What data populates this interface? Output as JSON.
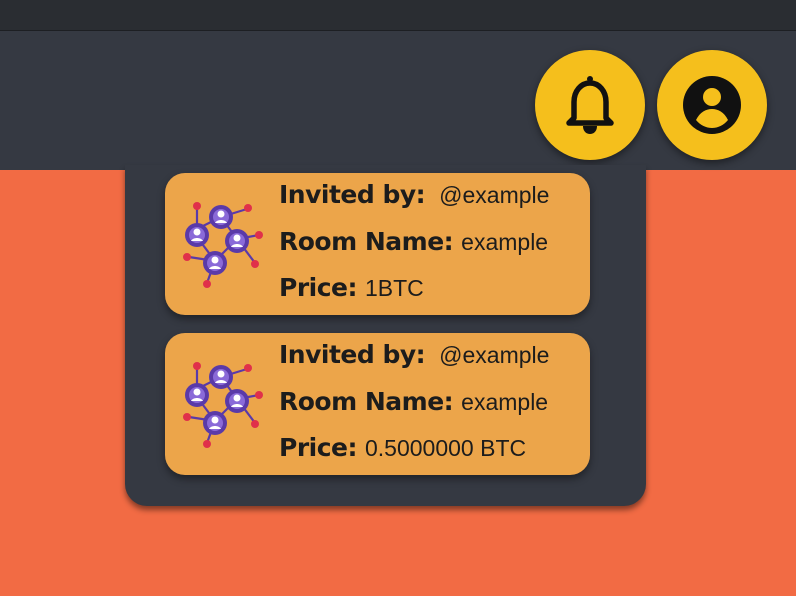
{
  "header": {
    "notification_icon": "bell-icon",
    "account_icon": "user-circle-icon"
  },
  "invites": [
    {
      "icon": "network-people-icon",
      "invited_by_label": "Invited by:",
      "invited_by": "@example",
      "room_name_label": "Room Name:",
      "room_name": "example",
      "price_label": "Price:",
      "price": "1BTC"
    },
    {
      "icon": "network-people-icon",
      "invited_by_label": "Invited by:",
      "invited_by": "@example",
      "room_name_label": "Room Name:",
      "room_name": "example",
      "price_label": "Price:",
      "price": "0.5000000 BTC"
    }
  ],
  "colors": {
    "background": "#f26b44",
    "header": "#353942",
    "accent_button": "#f5bf1c",
    "card": "#eca54a",
    "icon_purple": "#5a3aa8",
    "icon_red": "#e0304a"
  }
}
